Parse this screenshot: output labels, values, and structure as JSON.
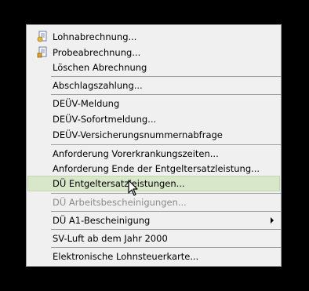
{
  "menu": {
    "items": [
      {
        "label": "Lohnabrechnung...",
        "icon": "payslip-icon"
      },
      {
        "label": "Probeabrechnung...",
        "icon": "trial-payslip-icon"
      },
      {
        "label": "Löschen Abrechnung"
      },
      {
        "label": "Abschlagszahlung..."
      },
      {
        "label": "DEÜV-Meldung"
      },
      {
        "label": "DEÜV-Sofortmeldung..."
      },
      {
        "label": "DEÜV-Versicherungsnummernabfrage"
      },
      {
        "label": "Anforderung Vorerkrankungszeiten..."
      },
      {
        "label": "Anforderung Ende der Entgeltersatzleistung..."
      },
      {
        "label": "DÜ Entgeltersatzleistungen...",
        "state": "highlighted"
      },
      {
        "label": "DÜ Arbeitsbescheinigungen...",
        "state": "disabled"
      },
      {
        "label": "DÜ A1-Bescheinigung",
        "submenu": true
      },
      {
        "label": "SV-Luft ab dem Jahr 2000"
      },
      {
        "label": "Elektronische Lohnsteuerkarte..."
      }
    ]
  },
  "colors": {
    "menu_background": "#f0f0f0",
    "highlight_background": "#d8e6c9",
    "highlight_border": "#c3d7ae",
    "disabled_text": "#8a8a8a",
    "separator": "#a0a0a0"
  }
}
